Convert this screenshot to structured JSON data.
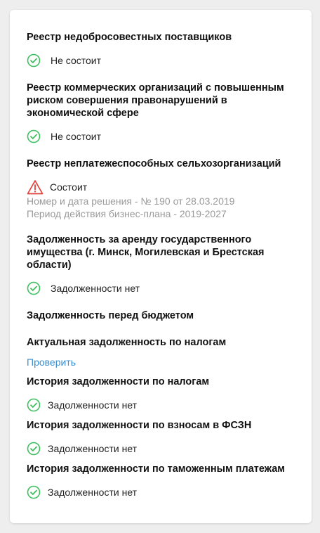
{
  "sections": [
    {
      "title": "Реестр недобросовестных поставщиков",
      "status": "Не состоит"
    },
    {
      "title_lines": [
        "Реестр коммерческих организаций с повышенным",
        "риском совершения правонарушений в",
        "экономической сфере"
      ],
      "status": "Не состоит"
    },
    {
      "title": "Реестр неплатежеспособных сельхозорганизаций",
      "status": "Состоит",
      "details": [
        "Номер и дата решения - № 190 от 28.03.2019",
        "Период действия бизнес-плана - 2019-2027"
      ]
    },
    {
      "title_lines": [
        "Задолженность за аренду государственного",
        "имущества (г. Минск, Могилевская и Брестская",
        "области)"
      ],
      "status": "Задолженности нет"
    }
  ],
  "budget": {
    "title": "Задолженность перед бюджетом",
    "actual_title": "Актуальная задолженность по налогам",
    "check_link": "Проверить",
    "items": [
      {
        "title": "История задолженности по налогам",
        "status": "Задолженности нет"
      },
      {
        "title": "История задолженности по взносам в ФСЗН",
        "status": "Задолженности нет"
      },
      {
        "title": "История задолженности по таможенным платежам",
        "status": "Задолженности нет"
      }
    ]
  },
  "colors": {
    "ok": "#3fbf5f",
    "warn": "#e0403a",
    "link": "#3a8fd0"
  },
  "icons": {
    "ok": "check-circle-icon",
    "warn": "warning-triangle-icon"
  }
}
